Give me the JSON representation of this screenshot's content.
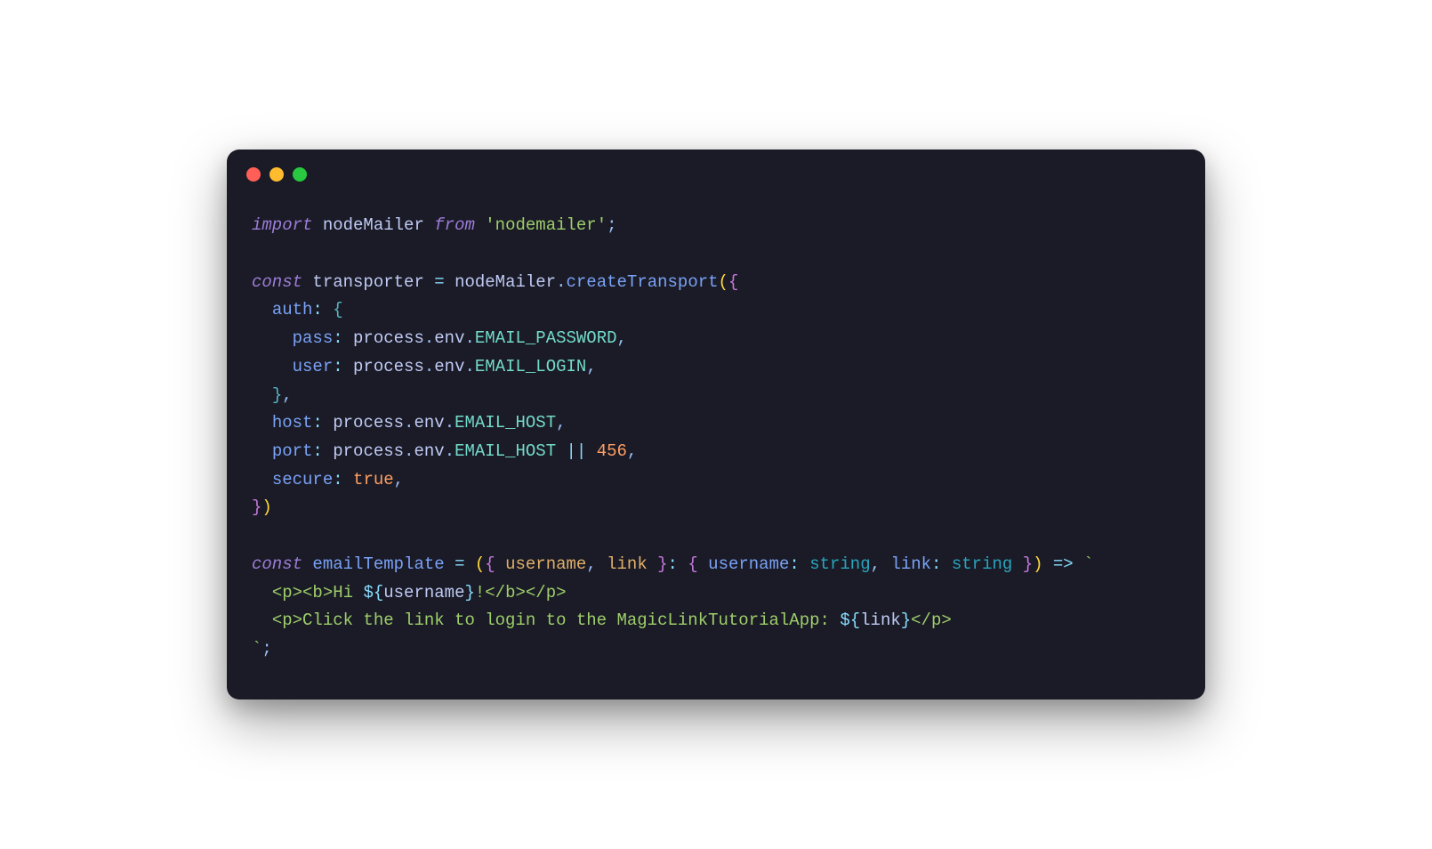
{
  "window": {
    "traffic_lights": [
      "close",
      "minimize",
      "maximize"
    ]
  },
  "code": {
    "lines": [
      {
        "type": "import",
        "tokens": {
          "kw_import": "import",
          "name": "nodeMailer",
          "kw_from": "from",
          "module": "'nodemailer'",
          "semi": ";"
        }
      },
      {
        "type": "blank"
      },
      {
        "type": "const_decl",
        "tokens": {
          "kw_const": "const",
          "varname": "transporter",
          "eq": "=",
          "obj": "nodeMailer",
          "dot": ".",
          "method": "createTransport",
          "open": "({"
        }
      },
      {
        "type": "prop_open",
        "indent": "  ",
        "tokens": {
          "key": "auth",
          "colon": ":",
          "brace": "{"
        }
      },
      {
        "type": "prop_env",
        "indent": "    ",
        "tokens": {
          "key": "pass",
          "colon": ":",
          "proc": "process",
          "dot1": ".",
          "env": "env",
          "dot2": ".",
          "var": "EMAIL_PASSWORD",
          "comma": ","
        }
      },
      {
        "type": "prop_env",
        "indent": "    ",
        "tokens": {
          "key": "user",
          "colon": ":",
          "proc": "process",
          "dot1": ".",
          "env": "env",
          "dot2": ".",
          "var": "EMAIL_LOGIN",
          "comma": ","
        }
      },
      {
        "type": "close_brace",
        "indent": "  ",
        "tokens": {
          "brace": "}",
          "comma": ","
        }
      },
      {
        "type": "prop_env",
        "indent": "  ",
        "tokens": {
          "key": "host",
          "colon": ":",
          "proc": "process",
          "dot1": ".",
          "env": "env",
          "dot2": ".",
          "var": "EMAIL_HOST",
          "comma": ","
        }
      },
      {
        "type": "prop_env_or",
        "indent": "  ",
        "tokens": {
          "key": "port",
          "colon": ":",
          "proc": "process",
          "dot1": ".",
          "env": "env",
          "dot2": ".",
          "var": "EMAIL_HOST",
          "or": "||",
          "num": "456",
          "comma": ","
        }
      },
      {
        "type": "prop_bool",
        "indent": "  ",
        "tokens": {
          "key": "secure",
          "colon": ":",
          "val": "true",
          "comma": ","
        }
      },
      {
        "type": "close_call",
        "tokens": {
          "close": "})"
        }
      },
      {
        "type": "blank"
      },
      {
        "type": "const_arrow",
        "tokens": {
          "kw_const": "const",
          "varname": "emailTemplate",
          "eq": "=",
          "open_paren": "(",
          "open_brace": "{",
          "p1": "username",
          "comma1": ",",
          "p2": "link",
          "close_brace": "}",
          "type_colon": ":",
          "type_open": "{",
          "t1_name": "username",
          "t1_colon": ":",
          "t1_type": "string",
          "t_comma": ",",
          "t2_name": "link",
          "t2_colon": ":",
          "t2_type": "string",
          "type_close": "}",
          "close_paren": ")",
          "arrow": "=>",
          "backtick": "`"
        }
      },
      {
        "type": "template_line",
        "indent": "  ",
        "tokens": {
          "pre": "<p><b>Hi ",
          "interp_open": "${",
          "interp_var": "username",
          "interp_close": "}",
          "post": "!</b></p>"
        }
      },
      {
        "type": "template_line",
        "indent": "  ",
        "tokens": {
          "pre": "<p>Click the link to login to the MagicLinkTutorialApp: ",
          "interp_open": "${",
          "interp_var": "link",
          "interp_close": "}",
          "post": "</p>"
        }
      },
      {
        "type": "template_end",
        "tokens": {
          "backtick": "`",
          "semi": ";"
        }
      }
    ]
  }
}
